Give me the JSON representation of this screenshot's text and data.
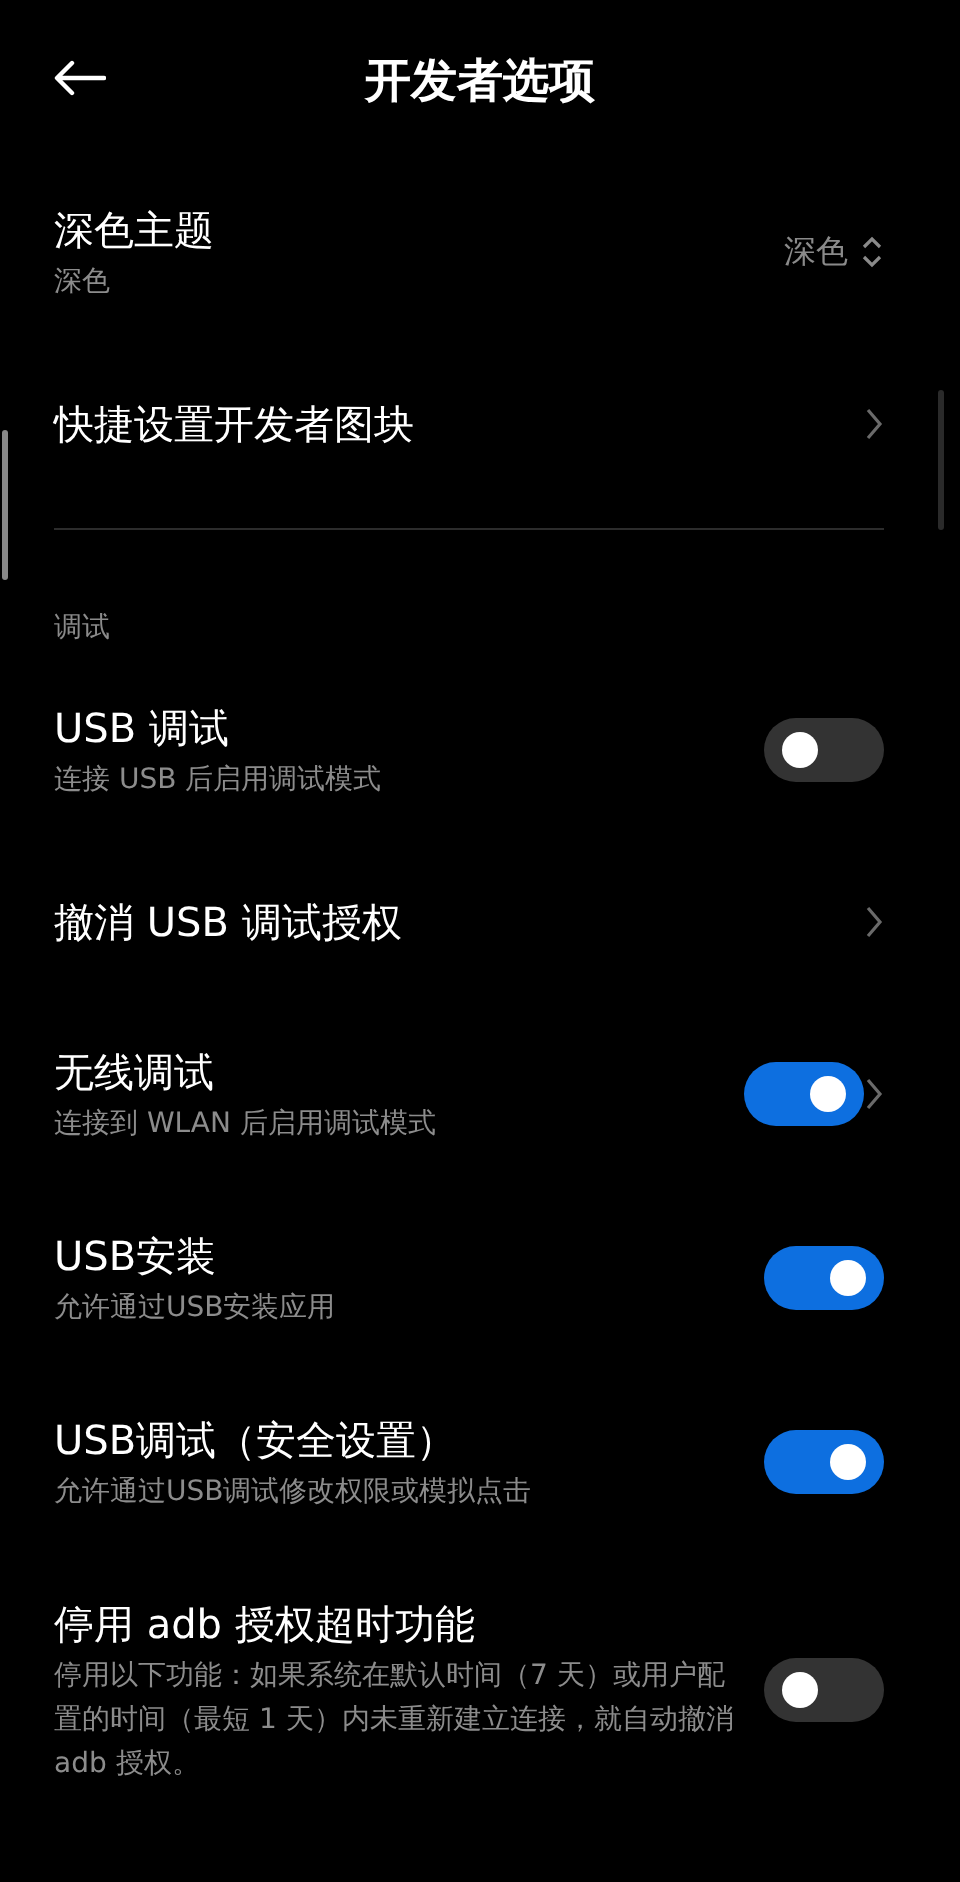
{
  "header": {
    "title": "开发者选项"
  },
  "groups": [
    {
      "items": [
        {
          "kind": "select",
          "title": "深色主题",
          "subtitle": "深色",
          "value": "深色"
        },
        {
          "kind": "link",
          "title": "快捷设置开发者图块"
        }
      ]
    },
    {
      "section": "调试",
      "items": [
        {
          "kind": "switch",
          "title": "USB 调试",
          "subtitle": "连接 USB 后启用调试模式",
          "on": false
        },
        {
          "kind": "link",
          "title": "撤消 USB 调试授权"
        },
        {
          "kind": "switch_link",
          "title": "无线调试",
          "subtitle": "连接到 WLAN 后启用调试模式",
          "on": true
        },
        {
          "kind": "switch",
          "title": "USB安装",
          "subtitle": "允许通过USB安装应用",
          "on": true
        },
        {
          "kind": "switch",
          "title": "USB调试（安全设置）",
          "subtitle": "允许通过USB调试修改权限或模拟点击",
          "on": true
        },
        {
          "kind": "switch",
          "title": "停用 adb 授权超时功能",
          "subtitle": "停用以下功能：如果系统在默认时间（7 天）或用户配置的时间（最短 1 天）内未重新建立连接，就自动撤消 adb 授权。",
          "on": false
        }
      ]
    }
  ]
}
